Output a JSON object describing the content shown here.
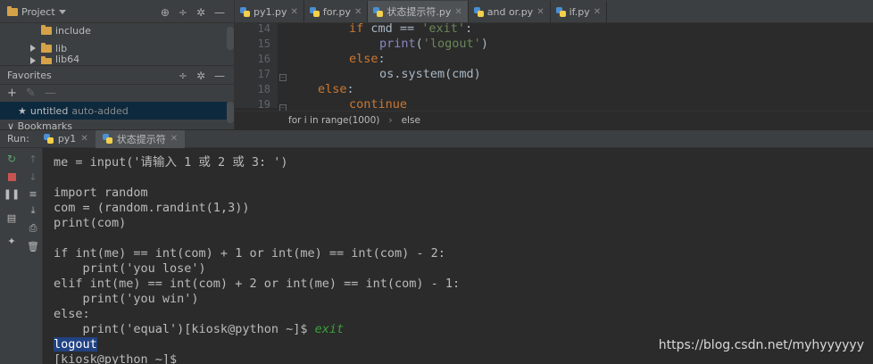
{
  "project_panel": {
    "header_label": "Project",
    "tree": [
      {
        "label": "include"
      },
      {
        "label": "lib"
      },
      {
        "label": "lib64"
      }
    ]
  },
  "favorites_panel": {
    "header_label": "Favorites",
    "item_label": "untitled",
    "item_note": "auto-added",
    "bookmarks_label": "Bookmarks"
  },
  "editor": {
    "tabs": [
      {
        "label": "py1.py"
      },
      {
        "label": "for.py"
      },
      {
        "label": "状态提示符.py"
      },
      {
        "label": "and or.py"
      },
      {
        "label": "if.py"
      }
    ],
    "active_tab_index": 2,
    "line_numbers": [
      "14",
      "15",
      "16",
      "17",
      "18",
      "19"
    ],
    "breadcrumb": [
      "for i in range(1000)",
      "else"
    ]
  },
  "run": {
    "label": "Run:",
    "tabs": [
      {
        "label": "py1"
      },
      {
        "label": "状态提示符"
      }
    ]
  },
  "console": {
    "lines": [
      "me = input('请输入 1 或 2 或 3: ')",
      "",
      "import random",
      "com = (random.randint(1,3))",
      "print(com)",
      "",
      "if int(me) == int(com) + 1 or int(me) == int(com) - 2:",
      "    print('you lose')",
      "elif int(me) == int(com) + 2 or int(me) == int(com) - 1:",
      "    print('you win')",
      "else:",
      "    print('equal')[kiosk@python ~]$ ",
      "",
      "[kiosk@python ~]$"
    ],
    "typed_command": "exit",
    "selected_output": "logout"
  },
  "watermark": "https://blog.csdn.net/myhyyyyyy"
}
